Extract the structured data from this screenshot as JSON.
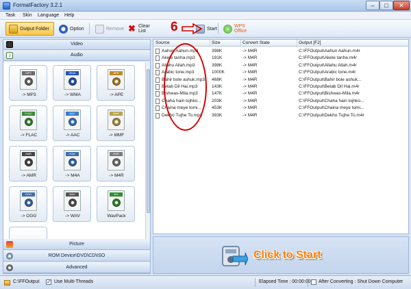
{
  "window": {
    "title": "FormatFactory 3.2.1",
    "min_glyph": "–",
    "max_glyph": "□",
    "close_glyph": "✕"
  },
  "menu": [
    "Task",
    "Skin",
    "Language",
    "Help"
  ],
  "toolbar": {
    "output_folder": "Output Folder",
    "option": "Option",
    "remove": "Remove",
    "clear_list": "Clear List",
    "start": "Start",
    "wps_office": "WPS Office"
  },
  "annotation_step": "6",
  "categories": {
    "video": "Video",
    "audio": "Audio",
    "picture": "Picture",
    "rom": "ROM Device\\DVD\\CD\\ISO",
    "advanced": "Advanced"
  },
  "audio_formats": [
    {
      "tag": "MP3",
      "label": "-> MP3",
      "color": "#6b6b6b"
    },
    {
      "tag": "WMA",
      "label": "-> WMA",
      "color": "#2456b8"
    },
    {
      "tag": "APE",
      "label": "-> APE",
      "color": "#c08a2a"
    },
    {
      "tag": "FLAC",
      "label": "-> FLAC",
      "color": "#3a8a3a"
    },
    {
      "tag": "AAC",
      "label": "-> AAC",
      "color": "#3a7fd0"
    },
    {
      "tag": "MMF",
      "label": "-> MMF",
      "color": "#b7a34a"
    },
    {
      "tag": "AMR",
      "label": "-> AMR",
      "color": "#444444"
    },
    {
      "tag": "M4A",
      "label": "-> M4A",
      "color": "#3a6fb0"
    },
    {
      "tag": "M4R",
      "label": "-> M4R",
      "color": "#7a7a7a"
    },
    {
      "tag": "OGG",
      "label": "-> OGG",
      "color": "#3a6fb0"
    },
    {
      "tag": "WAV",
      "label": "-> WAV",
      "color": "#555555"
    },
    {
      "tag": "WV",
      "label": "WavPack",
      "color": "#2f8f2f"
    }
  ],
  "file_list": {
    "columns": [
      "Source",
      "Size",
      "Convert State",
      "Output [F2]"
    ],
    "rows": [
      {
        "source": "Aahun Aahun.mp3",
        "size": "398K",
        "state": "-> M4R",
        "output": "C:\\FFOutput\\Aahun Aahun.m4r"
      },
      {
        "source": "Akele tanha.mp3",
        "size": "191K",
        "state": "-> M4R",
        "output": "C:\\FFOutput\\Akele tanha.m4r"
      },
      {
        "source": "Allahu Allah.mp3",
        "size": "398K",
        "state": "-> M4R",
        "output": "C:\\FFOutput\\Allahu Allah.m4r"
      },
      {
        "source": "Arabic tone.mp3",
        "size": "1000K",
        "state": "-> M4R",
        "output": "C:\\FFOutput\\Arabic tone.m4r"
      },
      {
        "source": "Bahir bole ashuk.mp3",
        "size": "468K",
        "state": "-> M4R",
        "output": "C:\\FFOutput\\Bahir bole ashuk..."
      },
      {
        "source": "Betab Dil Hai.mp3",
        "size": "143K",
        "state": "-> M4R",
        "output": "C:\\FFOutput\\Betab Dil Hai.m4r"
      },
      {
        "source": "Bishwas-Mila.mp3",
        "size": "147K",
        "state": "-> M4R",
        "output": "C:\\FFOutput\\Bishwas-Mila.m4r"
      },
      {
        "source": "Chaha hain tojhko...",
        "size": "203K",
        "state": "-> M4R",
        "output": "C:\\FFOutput\\Chaha hain tojhko..."
      },
      {
        "source": "Chaina meye tomi...",
        "size": "453K",
        "state": "-> M4R",
        "output": "C:\\FFOutput\\Chaina meye tomi..."
      },
      {
        "source": "Dekho Tujhe To.mp3",
        "size": "393K",
        "state": "-> M4R",
        "output": "C:\\FFOutput\\Dekho Tujhe To.m4r"
      }
    ]
  },
  "start_button": "Click to Start",
  "status": {
    "output_path": "C:\\FFOutput",
    "multi_threads": "Use Multi-Threads",
    "elapsed": "Elapsed Time : 00:00:00",
    "after_converting": "After Converting : Shut Down Computer"
  },
  "colors": {
    "accent_orange": "#ff7a00",
    "annotation_red": "#d60000",
    "panel_blue": "#c7d8ef"
  }
}
